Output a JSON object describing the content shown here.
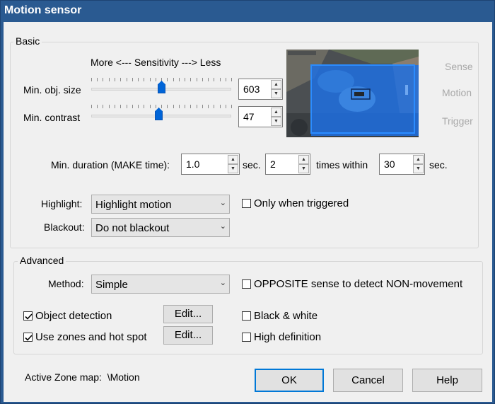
{
  "window": {
    "title": "Motion sensor"
  },
  "basic": {
    "legend": "Basic",
    "sensitivity_header": "More <--- Sensitivity ---> Less",
    "min_obj_size": {
      "label": "Min. obj. size",
      "value": "603",
      "slider_fraction": 0.5
    },
    "min_contrast": {
      "label": "Min. contrast",
      "value": "47",
      "slider_fraction": 0.48
    },
    "preview_labels": [
      "Sense",
      "Motion",
      "Trigger"
    ],
    "duration": {
      "label": "Min. duration (MAKE time):",
      "value": "1.0",
      "unit": "sec.",
      "times_value": "2",
      "times_label": "times within",
      "within_value": "30",
      "within_unit": "sec."
    },
    "highlight": {
      "label": "Highlight:",
      "value": "Highlight motion"
    },
    "only_triggered": {
      "label": "Only when triggered",
      "checked": false
    },
    "blackout": {
      "label": "Blackout:",
      "value": "Do not blackout"
    }
  },
  "advanced": {
    "legend": "Advanced",
    "method": {
      "label": "Method:",
      "value": "Simple"
    },
    "opposite": {
      "label": "OPPOSITE sense to detect NON-movement",
      "checked": false
    },
    "object_detection": {
      "label": "Object detection",
      "checked": true,
      "edit_label": "Edit..."
    },
    "use_zones": {
      "label": "Use zones and hot spot",
      "checked": true,
      "edit_label": "Edit..."
    },
    "black_white": {
      "label": "Black & white",
      "checked": false
    },
    "high_def": {
      "label": "High definition",
      "checked": false
    }
  },
  "footer": {
    "active_zone_label": "Active Zone map:",
    "active_zone_value": "\\Motion",
    "ok": "OK",
    "cancel": "Cancel",
    "help": "Help"
  },
  "colors": {
    "titlebar": "#2a5a91",
    "accent": "#0078d7",
    "slider_thumb": "#0064d7",
    "zone_overlay": "#1e6fe0"
  },
  "icons": {
    "spin_up": "▲",
    "spin_down": "▼",
    "combo_arrow": "⌄"
  }
}
